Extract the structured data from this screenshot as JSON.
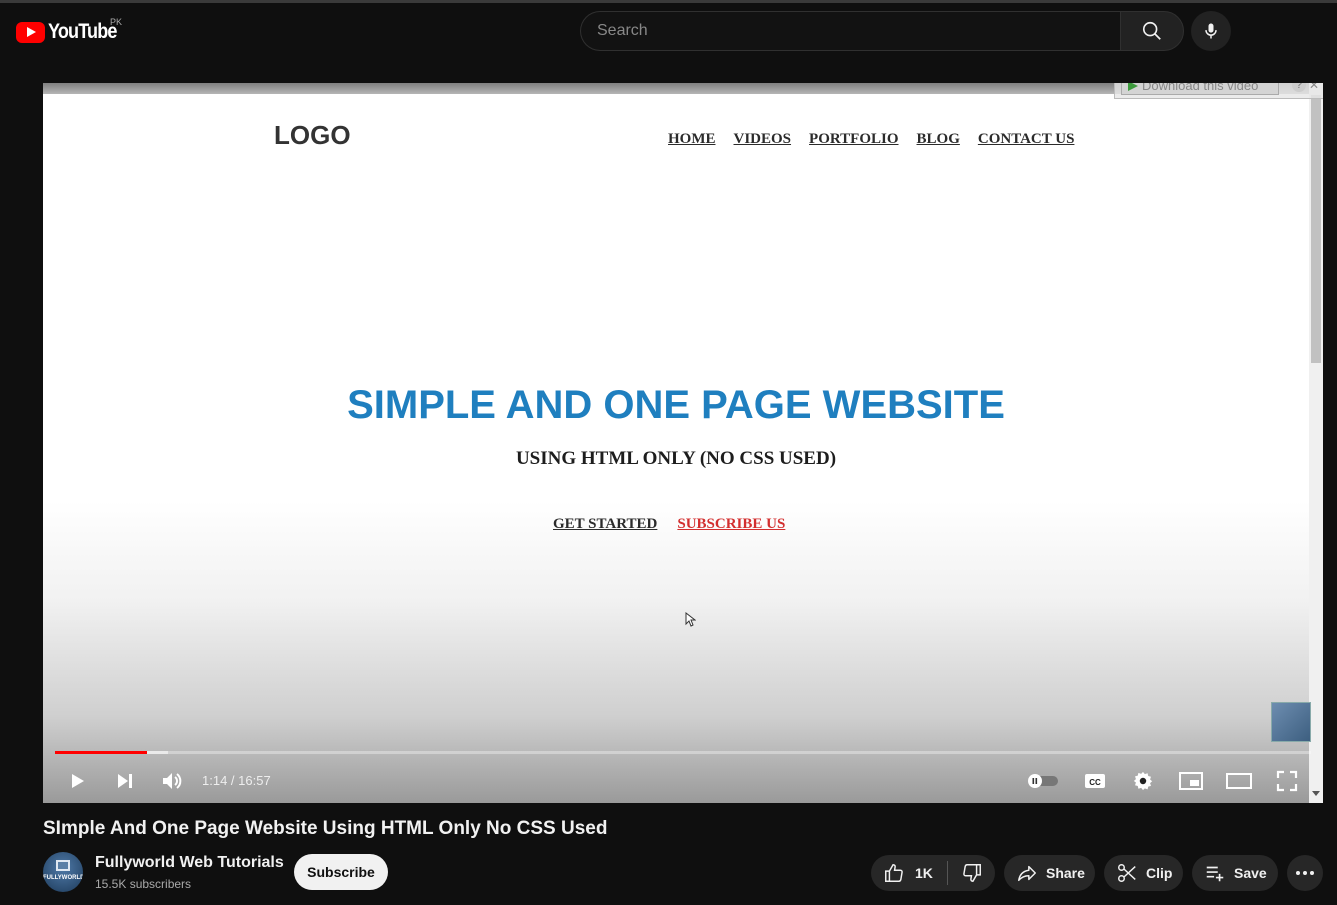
{
  "masthead": {
    "logo_text": "YouTube",
    "region": "PK",
    "search_placeholder": "Search"
  },
  "video_content": {
    "site_logo": "LOGO",
    "nav": [
      "HOME",
      "VIDEOS",
      "PORTFOLIO",
      "BLOG",
      "CONTACT US"
    ],
    "hero_title": "SIMPLE AND ONE PAGE WEBSITE",
    "hero_subtitle": "USING HTML ONLY (NO CSS USED)",
    "get_started": "GET STARTED",
    "subscribe_us": "SUBSCRIBE US",
    "download_label": "Download this video",
    "download_help": "?",
    "download_close": "✕"
  },
  "player": {
    "time_display": "1:14 / 16:57",
    "played_fraction": 0.073,
    "buffered_fraction": 0.09
  },
  "video": {
    "title": "SImple And One Page Website Using HTML Only No CSS Used"
  },
  "channel": {
    "name": "Fullyworld Web Tutorials",
    "subscribers": "15.5K subscribers",
    "avatar_text": "FULLYWORLD",
    "subscribe_label": "Subscribe"
  },
  "actions": {
    "likes": "1K",
    "share_label": "Share",
    "clip_label": "Clip",
    "save_label": "Save"
  },
  "colors": {
    "background": "#0f0f0f",
    "brand_red": "#ff0000",
    "hero_blue": "#1f7fbf",
    "subscribe_red": "#d32f2f"
  }
}
